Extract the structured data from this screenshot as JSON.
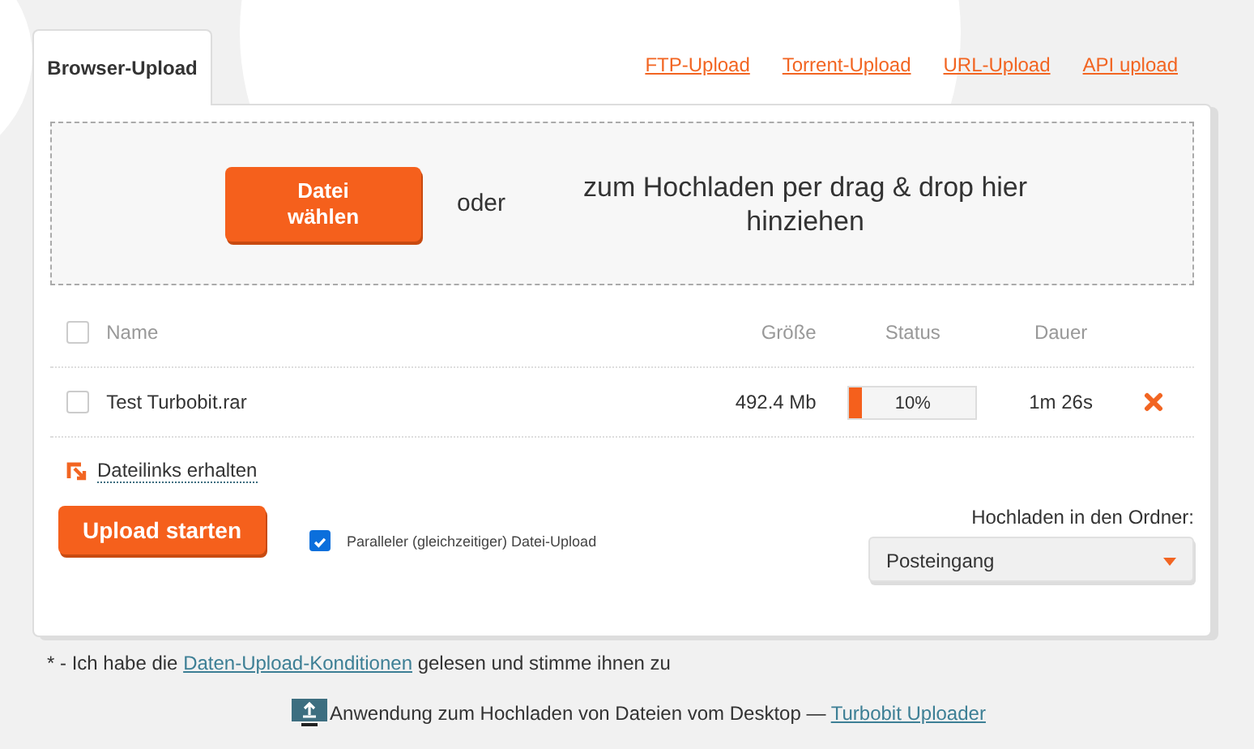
{
  "tabs": [
    {
      "label": "Browser-Upload",
      "selected": true
    },
    {
      "label": "FTP-Upload",
      "selected": false
    },
    {
      "label": "Torrent-Upload",
      "selected": false
    },
    {
      "label": "URL-Upload",
      "selected": false
    },
    {
      "label": "API upload",
      "selected": false
    }
  ],
  "dropzone": {
    "button": "Datei wählen",
    "or": "oder",
    "hint": "zum Hochladen per drag & drop hier hinziehen"
  },
  "table": {
    "select_all_checked": false,
    "columns": [
      "Name",
      "Größe",
      "Status",
      "Dauer"
    ],
    "rows": [
      {
        "checked": false,
        "name": "Test Turbobit.rar",
        "size": "492.4  Mb",
        "level": 0.1,
        "progress": "10%",
        "duration": "1m 26s"
      }
    ]
  },
  "links_button": "Dateilinks erhalten",
  "start_button": "Upload starten",
  "parallel": {
    "checked": true,
    "label": "Paralleler (gleichzeitiger) Datei-Upload"
  },
  "folder": {
    "label": "Hochladen in den Ordner:",
    "value": "Posteingang"
  },
  "terms": {
    "before": "* - Ich habe die ",
    "link": "Daten-Upload-Konditionen",
    "after": " gelesen und stimme ihnen zu"
  },
  "app_note": {
    "text": "Anwendung zum Hochladen von Dateien vom Desktop — ",
    "link": "Turbobit Uploader"
  }
}
